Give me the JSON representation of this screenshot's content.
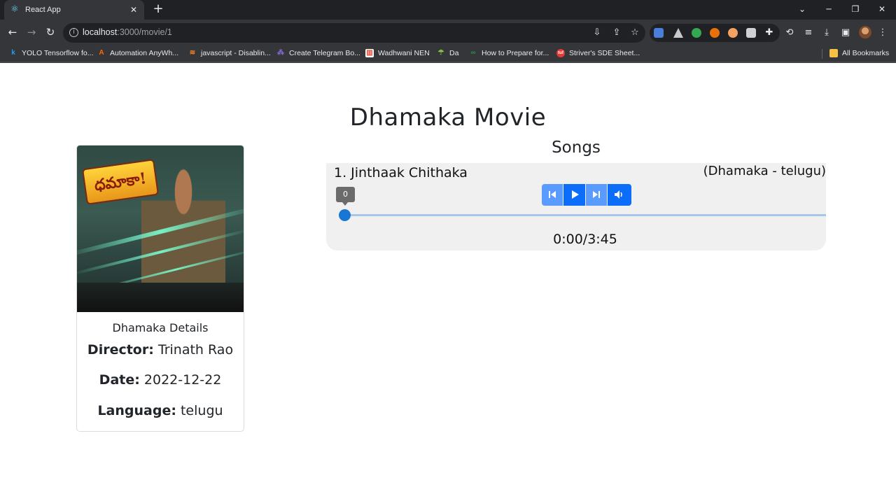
{
  "browser": {
    "tab_title": "React App",
    "tab_close": "✕",
    "new_tab": "+",
    "url_host": "localhost",
    "url_rest": ":3000/movie/1",
    "bookmarks": [
      {
        "label": "YOLO Tensorflow fo...",
        "icon": "k-icon",
        "color": "#1da1f2"
      },
      {
        "label": "Automation AnyWh...",
        "icon": "a-icon",
        "color": "#ff6a00"
      },
      {
        "label": "javascript - Disablin...",
        "icon": "stackoverflow-icon",
        "color": "#f48024"
      },
      {
        "label": "Create Telegram Bo...",
        "icon": "network-icon",
        "color": "#8a6ad8"
      },
      {
        "label": "Wadhwani NEN",
        "icon": "wadhwani-icon",
        "color": "#e14b3b"
      },
      {
        "label": "Da",
        "icon": "umbrella-icon",
        "color": "#8bc34a"
      },
      {
        "label": "How to Prepare for...",
        "icon": "gfg-icon",
        "color": "#2f8d46"
      },
      {
        "label": "Striver's SDE Sheet...",
        "icon": "tuf-icon",
        "color": "#e53935"
      }
    ],
    "all_bookmarks": "All Bookmarks"
  },
  "page": {
    "title": "Dhamaka Movie",
    "card": {
      "subtitle": "Dhamaka Details",
      "director_label": "Director:",
      "director": "Trinath Rao",
      "date_label": "Date:",
      "date": "2022-12-22",
      "language_label": "Language:",
      "language": "telugu"
    },
    "songs_title": "Songs",
    "player": {
      "song_name": "1. Jinthaak Chithaka",
      "song_meta": "(Dhamaka - telugu)",
      "slider_value_label": "0",
      "progress_fraction": 0,
      "time": "0:00/3:45"
    }
  }
}
